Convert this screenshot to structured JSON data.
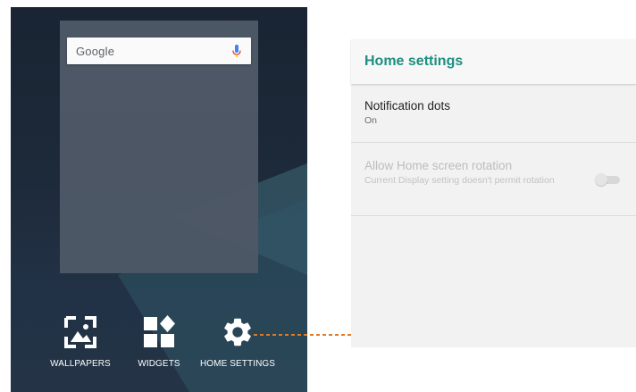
{
  "launcher": {
    "search_brand": "Google",
    "options": [
      {
        "label": "WALLPAPERS",
        "icon": "wallpaper-icon"
      },
      {
        "label": "WIDGETS",
        "icon": "widgets-icon"
      },
      {
        "label": "HOME SETTINGS",
        "icon": "gear-icon"
      }
    ]
  },
  "settings": {
    "title": "Home settings",
    "items": [
      {
        "title": "Notification dots",
        "summary": "On"
      },
      {
        "title": "Allow Home screen rotation",
        "summary": "Current Display setting doesn't permit rotation",
        "enabled": false,
        "toggle_on": false
      }
    ]
  },
  "colors": {
    "accent": "#1d8f80",
    "connector": "#e07a26",
    "phone_bg": "#1d2a3a"
  }
}
